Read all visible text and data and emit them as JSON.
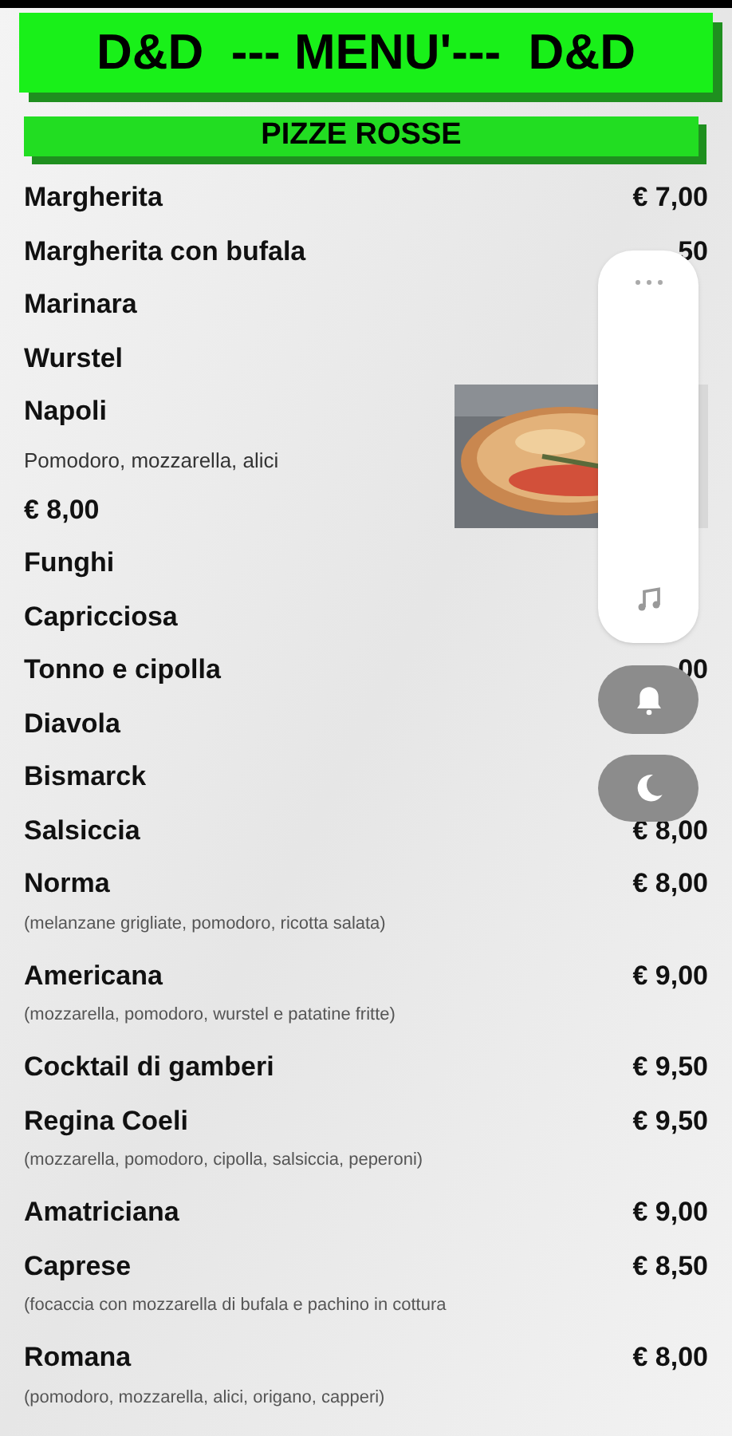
{
  "header": {
    "title": "D&D  --- MENU'---  D&D"
  },
  "section": {
    "title": "PIZZE ROSSE"
  },
  "items": [
    {
      "kind": "row",
      "name": "Margherita",
      "price": "€ 7,00"
    },
    {
      "kind": "row",
      "name": "Margherita con bufala",
      "price": "50"
    },
    {
      "kind": "row",
      "name": "Marinara"
    },
    {
      "kind": "row",
      "name": "Wurstel"
    },
    {
      "name": "Napoli",
      "description": "Pomodoro, mozzarella, alici",
      "price": "€ 8,00"
    },
    {
      "kind": "row",
      "name": "Funghi"
    },
    {
      "kind": "row",
      "name": "Capricciosa"
    },
    {
      "kind": "row",
      "name": "Tonno e cipolla",
      "price": "00"
    },
    {
      "kind": "row",
      "name": "Diavola"
    },
    {
      "kind": "row",
      "name": "Bismarck"
    },
    {
      "kind": "row",
      "name": "Salsiccia",
      "price": "€ 8,00"
    },
    {
      "kind": "row",
      "name": "Norma",
      "price": "€ 8,00",
      "description": "(melanzane grigliate, pomodoro, ricotta salata)"
    },
    {
      "kind": "row",
      "name": "Americana",
      "price": "€ 9,00",
      "description": "(mozzarella, pomodoro, wurstel e patatine fritte)"
    },
    {
      "kind": "row",
      "name": "Cocktail di gamberi",
      "price": "€ 9,50"
    },
    {
      "kind": "row",
      "name": "Regina Coeli",
      "price": "€ 9,50",
      "description": "(mozzarella, pomodoro, cipolla, salsiccia, peperoni)"
    },
    {
      "kind": "row",
      "name": "Amatriciana",
      "price": "€ 9,00"
    },
    {
      "kind": "row",
      "name": "Caprese",
      "price": "€ 8,50",
      "description": "(focaccia con mozzarella di bufala e pachino in cottura"
    },
    {
      "kind": "row",
      "name": "Romana",
      "price": "€ 8,00",
      "description": "(pomodoro, mozzarella, alici, origano, capperi)"
    }
  ]
}
